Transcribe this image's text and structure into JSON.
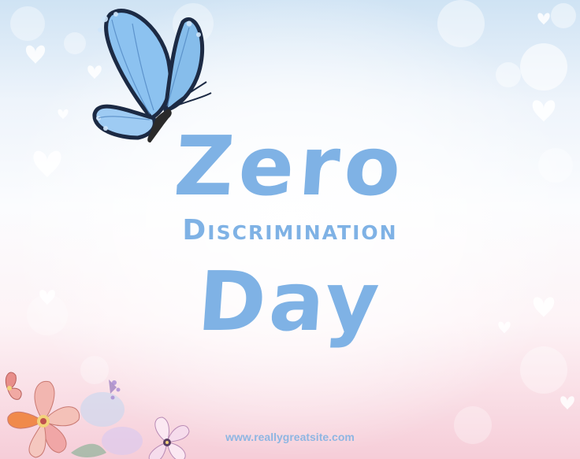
{
  "poster": {
    "title_line1": "Zero",
    "title_line2": "Discrimination",
    "title_line3": "Day",
    "website": "www.reallygreatsite.com"
  },
  "colors": {
    "title": "#7fb2e5",
    "butterfly_wing": "#8cc2f0",
    "butterfly_edge": "#1c2a44",
    "flower_pink": "#f0a6a6",
    "flower_orange": "#f08a4b",
    "background_top": "#cfe3f4",
    "background_bottom": "#f6cdd8"
  },
  "icons": {
    "butterfly": "butterfly-icon",
    "flowers": "flower-cluster-icon",
    "hearts": "heart-icon"
  }
}
